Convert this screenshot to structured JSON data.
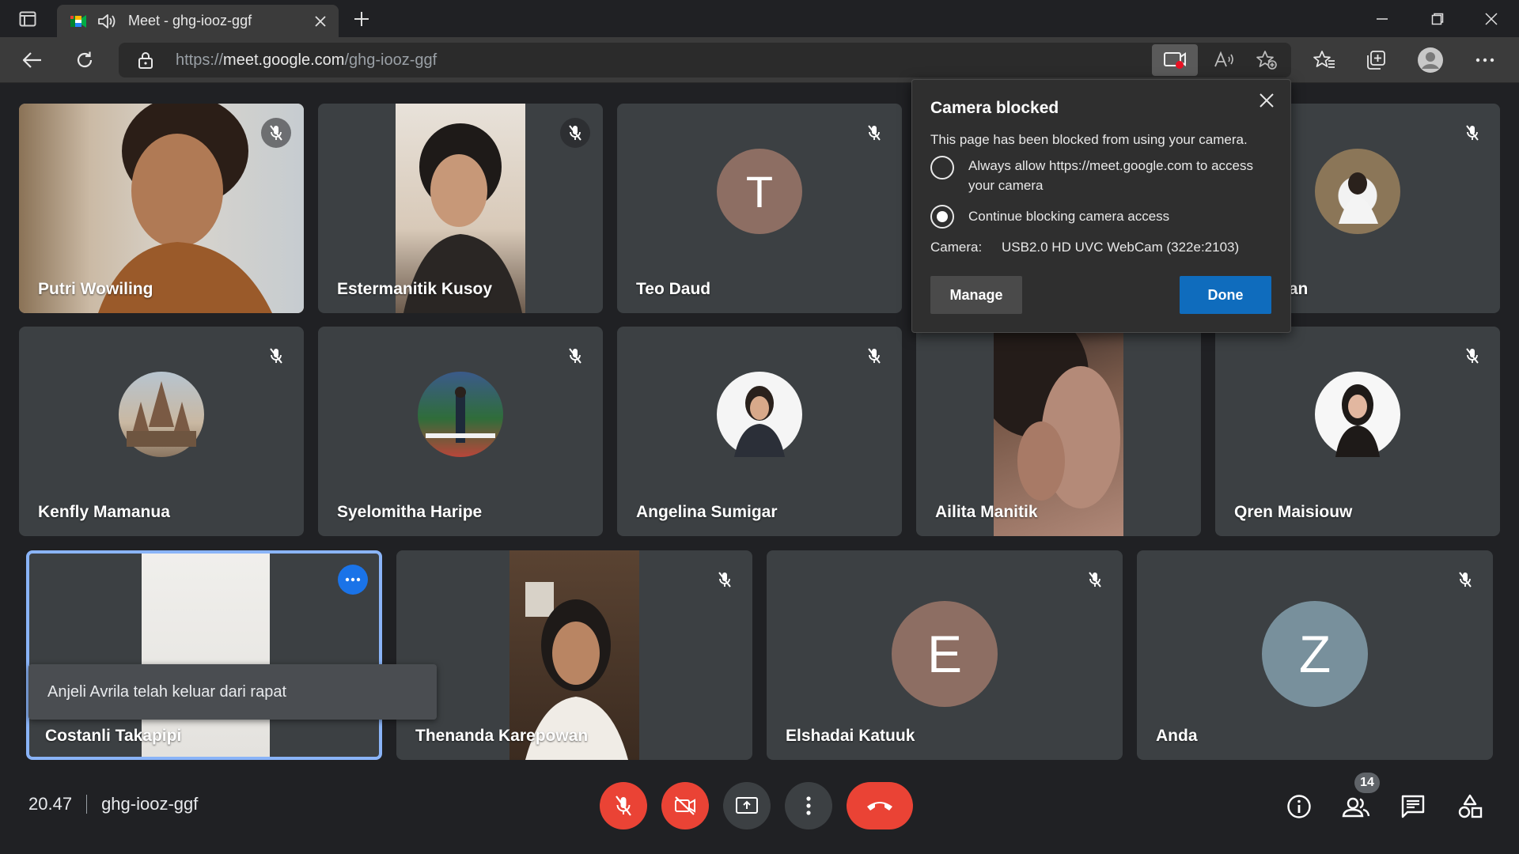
{
  "browser": {
    "tab_title": "Meet - ghg-iooz-ggf",
    "url_scheme": "https://",
    "url_domain": "meet.google.com",
    "url_path": "/ghg-iooz-ggf"
  },
  "tiles": [
    {
      "name": "Putri Wowiling"
    },
    {
      "name": "Estermanitik Kusoy"
    },
    {
      "name": "Teo Daud",
      "initial": "T"
    },
    {
      "name": "ombaitan"
    },
    {
      "name": "Kenfly Mamanua"
    },
    {
      "name": "Syelomitha Haripe"
    },
    {
      "name": "Angelina Sumigar"
    },
    {
      "name": "Ailita Manitik"
    },
    {
      "name": "Qren Maisiouw"
    },
    {
      "name": "Costanli Takapipi"
    },
    {
      "name": "Thenanda Karepowan"
    },
    {
      "name": "Elshadai Katuuk",
      "initial": "E"
    },
    {
      "name": "Anda",
      "initial": "Z"
    }
  ],
  "toast": "Anjeli Avrila telah keluar dari rapat",
  "bottom": {
    "time": "20.47",
    "meeting_code": "ghg-iooz-ggf",
    "participants_count": "14"
  },
  "popup": {
    "title": "Camera blocked",
    "message": "This page has been blocked from using your camera.",
    "option_allow": "Always allow https://meet.google.com to access your camera",
    "option_block": "Continue blocking camera access",
    "selected_option": "block",
    "camera_label": "Camera:",
    "camera_value": "USB2.0 HD UVC WebCam (322e:2103)",
    "manage_label": "Manage",
    "done_label": "Done"
  },
  "colors": {
    "avatar_brown": "#8d6e63",
    "avatar_slate": "#78909c",
    "hangup_red": "#ea4335",
    "accent_blue": "#0f6cbd",
    "pin_blue": "#1a73e8"
  }
}
